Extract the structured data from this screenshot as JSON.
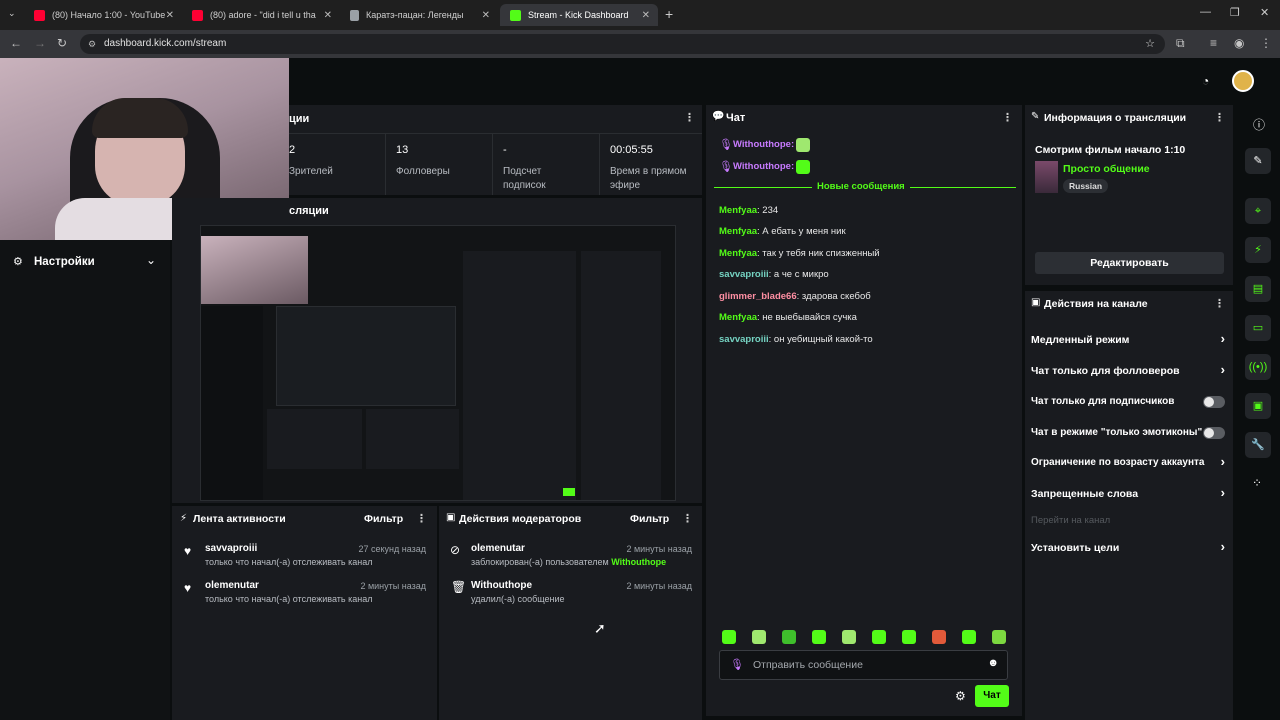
{
  "browser": {
    "tabs": [
      {
        "label": "(80) Начало 1:00 - YouTube",
        "color": "#ff0033"
      },
      {
        "label": "(80) adore - \"did i tell u tha",
        "color": "#ff0033"
      },
      {
        "label": "Каратэ-пацан: Легенды",
        "color": "#9aa0a6"
      },
      {
        "label": "Stream - Kick Dashboard",
        "color": "#53fc18"
      }
    ],
    "url": "dashboard.kick.com/stream"
  },
  "stats": {
    "title": "ции",
    "items": [
      {
        "value": "2",
        "label": "Зрителей"
      },
      {
        "value": "13",
        "label": "Фолловеры"
      },
      {
        "value": "-",
        "label": "Подсчет подписок"
      },
      {
        "value": "00:05:55",
        "label": "Время в прямом эфире"
      }
    ]
  },
  "preview": {
    "title": "сляции"
  },
  "sidebar": {
    "settings_label": "Настройки"
  },
  "activity": {
    "title": "Лента активности",
    "filter": "Фильтр",
    "items": [
      {
        "name": "savvaproiii",
        "desc": "только что начал(-а) отслеживать канал",
        "time": "27 секунд назад"
      },
      {
        "name": "olemenutar",
        "desc": "только что начал(-а) отслеживать канал",
        "time": "2 минуты назад"
      }
    ]
  },
  "modactions": {
    "title": "Действия модераторов",
    "filter": "Фильтр",
    "items": [
      {
        "name": "olemenutar",
        "desc": "заблокирован(-а) пользователем",
        "target": "Withouthope",
        "time": "2 минуты назад"
      },
      {
        "name": "Withouthope",
        "desc": "удалил(-а) сообщение",
        "target": "",
        "time": "2 минуты назад"
      }
    ]
  },
  "chat": {
    "title": "Чат",
    "pinned": [
      {
        "user": "Withouthope:"
      },
      {
        "user": "Withouthope:"
      }
    ],
    "new_messages": "Новые сообщения",
    "messages": [
      {
        "user": "Menfyaa",
        "text": ": 234",
        "color": "#53fc18"
      },
      {
        "user": "Menfyaa",
        "text": ": А ебать у меня ник",
        "color": "#53fc18"
      },
      {
        "user": "Menfyaa",
        "text": ": так у тебя ник спизженный",
        "color": "#53fc18"
      },
      {
        "user": "savvaproiii",
        "text": ": а че с микро",
        "color": "#75d3c2"
      },
      {
        "user": "glimmer_blade66",
        "text": ": здарова скебоб",
        "color": "#ff8fa3"
      },
      {
        "user": "Menfyaa",
        "text": ": не выебывайся сучка",
        "color": "#53fc18"
      },
      {
        "user": "savvaproiii",
        "text": ": он уебищный какой-то",
        "color": "#75d3c2"
      }
    ],
    "input_placeholder": "Отправить сообщение",
    "send_label": "Чат"
  },
  "streaminfo": {
    "title": "Информация о трансляции",
    "stream_title": "Смотрим фильм начало 1:10",
    "category": "Просто общение",
    "language": "Russian",
    "edit_label": "Редактировать"
  },
  "channel_actions": {
    "title": "Действия на канале",
    "items": [
      {
        "label": "Медленный режим",
        "kind": "chevron"
      },
      {
        "label": "Чат только для фолловеров",
        "kind": "chevron"
      },
      {
        "label": "Чат только для подписчиков",
        "kind": "toggle"
      },
      {
        "label": "Чат в режиме \"только эмотиконы\"",
        "kind": "toggle"
      },
      {
        "label": "Ограничение по возрасту аккаунта",
        "kind": "chevron"
      },
      {
        "label": "Запрещенные слова",
        "kind": "chevron"
      },
      {
        "label": "Перейти на канал",
        "kind": "disabled"
      },
      {
        "label": "Установить цели",
        "kind": "chevron"
      }
    ]
  }
}
